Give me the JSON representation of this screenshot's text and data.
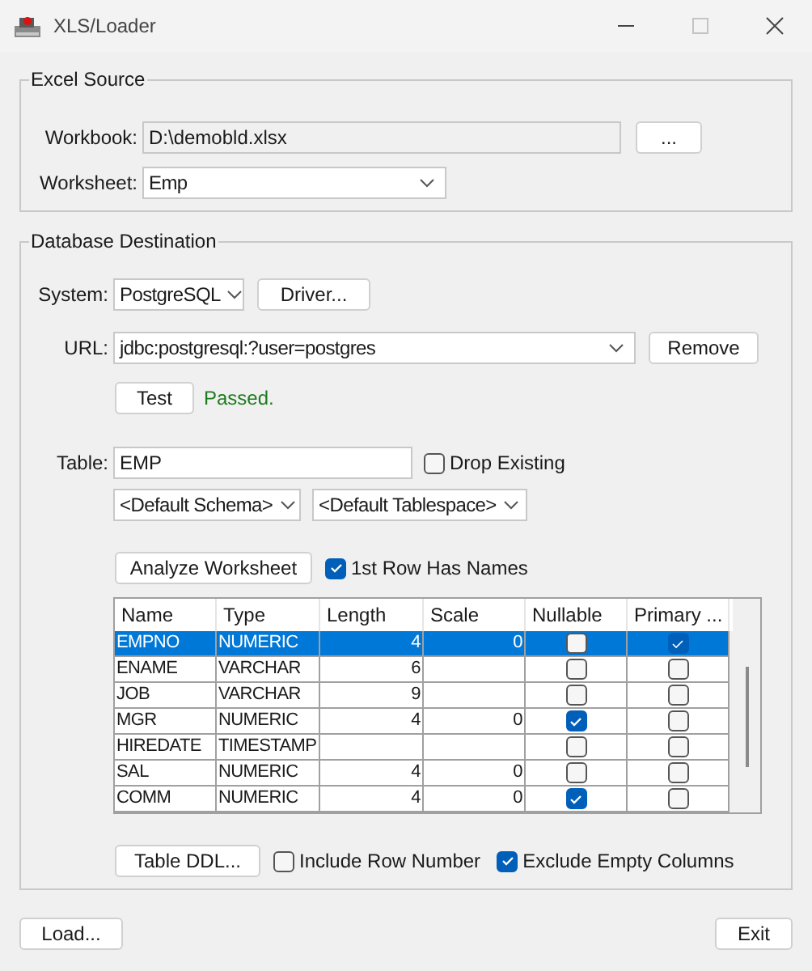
{
  "window": {
    "title": "XLS/Loader"
  },
  "excel_source": {
    "title": "Excel Source",
    "workbook": {
      "label": "Workbook:",
      "value": "D:\\demobld.xlsx",
      "button": "..."
    },
    "worksheet": {
      "label": "Worksheet:",
      "value": "Emp"
    }
  },
  "database_destination": {
    "title": "Database Destination",
    "system": {
      "label": "System:",
      "value": "PostgreSQL",
      "button": "Driver..."
    },
    "url": {
      "label": "URL:",
      "value": "jdbc:postgresql:?user=postgres",
      "button": "Remove"
    },
    "test": {
      "button": "Test",
      "status": "Passed."
    },
    "table": {
      "label": "Table:",
      "value": "EMP",
      "drop_existing": {
        "label": "Drop Existing",
        "checked": false
      }
    },
    "schema": "<Default Schema>",
    "tablespace": "<Default Tablespace>",
    "analyze": {
      "button": "Analyze Worksheet",
      "first_row_has_names": {
        "label": "1st Row Has Names",
        "checked": true
      }
    },
    "grid": {
      "columns": [
        "Name",
        "Type",
        "Length",
        "Scale",
        "Nullable",
        "Primary ..."
      ],
      "rows": [
        {
          "name": "EMPNO",
          "type": "NUMERIC",
          "length": "4",
          "scale": "0",
          "nullable": false,
          "primary": true,
          "selected": true
        },
        {
          "name": "ENAME",
          "type": "VARCHAR",
          "length": "6",
          "nullable": false,
          "primary": false,
          "selected": false
        },
        {
          "name": "JOB",
          "type": "VARCHAR",
          "length": "9",
          "nullable": false,
          "primary": false,
          "selected": false
        },
        {
          "name": "MGR",
          "type": "NUMERIC",
          "length": "4",
          "scale": "0",
          "nullable": true,
          "primary": false,
          "selected": false
        },
        {
          "name": "HIREDATE",
          "type": "TIMESTAMP",
          "nullable": false,
          "primary": false,
          "selected": false
        },
        {
          "name": "SAL",
          "type": "NUMERIC",
          "length": "4",
          "scale": "0",
          "nullable": false,
          "primary": false,
          "selected": false
        },
        {
          "name": "COMM",
          "type": "NUMERIC",
          "length": "4",
          "scale": "0",
          "nullable": true,
          "primary": false,
          "selected": false
        }
      ]
    },
    "table_ddl": {
      "button": "Table DDL...",
      "include_row_number": {
        "label": "Include Row Number",
        "checked": false
      },
      "exclude_empty_columns": {
        "label": "Exclude Empty Columns",
        "checked": true
      }
    }
  },
  "buttons": {
    "load": "Load...",
    "exit": "Exit"
  }
}
